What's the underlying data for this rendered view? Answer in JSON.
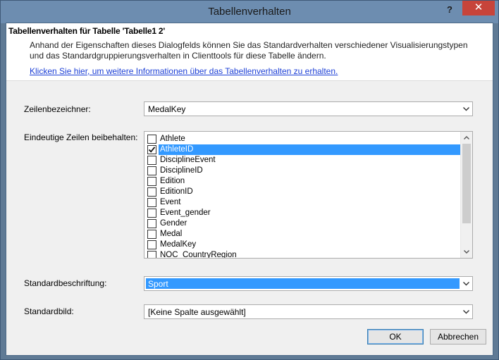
{
  "window": {
    "title": "Tabellenverhalten",
    "help_label": "?",
    "close_label": "✕"
  },
  "header": {
    "title": "Tabellenverhalten für Tabelle 'Tabelle1 2'",
    "description": "Anhand der Eigenschaften dieses Dialogfelds können Sie das Standardverhalten verschiedener Visualisierungstypen und das Standardgruppierungsverhalten in Clienttools für diese Tabelle ändern.",
    "link": "Klicken Sie hier, um weitere Informationen über das Tabellenverhalten zu erhalten."
  },
  "row_identifier": {
    "label": "Zeilenbezeichner:",
    "value": "MedalKey"
  },
  "keep_unique_rows": {
    "label": "Eindeutige Zeilen beibehalten:",
    "items": [
      {
        "label": "Athlete",
        "checked": false,
        "highlighted": false
      },
      {
        "label": "AthleteID",
        "checked": true,
        "highlighted": true
      },
      {
        "label": "DisciplineEvent",
        "checked": false,
        "highlighted": false
      },
      {
        "label": "DisciplineID",
        "checked": false,
        "highlighted": false
      },
      {
        "label": "Edition",
        "checked": false,
        "highlighted": false
      },
      {
        "label": "EditionID",
        "checked": false,
        "highlighted": false
      },
      {
        "label": "Event",
        "checked": false,
        "highlighted": false
      },
      {
        "label": "Event_gender",
        "checked": false,
        "highlighted": false
      },
      {
        "label": "Gender",
        "checked": false,
        "highlighted": false
      },
      {
        "label": "Medal",
        "checked": false,
        "highlighted": false
      },
      {
        "label": "MedalKey",
        "checked": false,
        "highlighted": false
      },
      {
        "label": "NOC_CountryRegion",
        "checked": false,
        "highlighted": false
      }
    ]
  },
  "default_label": {
    "label": "Standardbeschriftung:",
    "value": "Sport"
  },
  "default_image": {
    "label": "Standardbild:",
    "value": "[Keine Spalte ausgewählt]"
  },
  "buttons": {
    "ok": "OK",
    "cancel": "Abbrechen"
  },
  "colors": {
    "selection": "#3399ff",
    "link": "#1c3fd6",
    "close_button": "#c7443a",
    "titlebar": "#6d8db0"
  }
}
